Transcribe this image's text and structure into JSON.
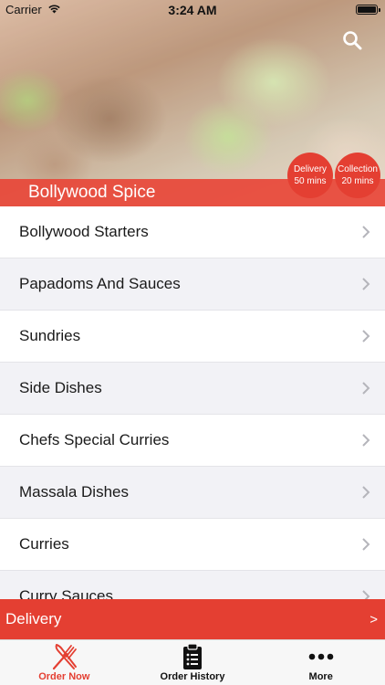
{
  "status_bar": {
    "carrier": "Carrier",
    "time": "3:24 AM"
  },
  "header": {
    "restaurant_name": "Bollywood Spice",
    "delivery_badge": {
      "label": "Delivery",
      "time": "50 mins"
    },
    "collection_badge": {
      "label": "Collection",
      "time": "20 mins"
    }
  },
  "menu": {
    "items": [
      {
        "label": "Bollywood Starters"
      },
      {
        "label": "Papadoms And Sauces"
      },
      {
        "label": "Sundries"
      },
      {
        "label": "Side Dishes"
      },
      {
        "label": "Chefs Special Curries"
      },
      {
        "label": "Massala Dishes"
      },
      {
        "label": "Curries"
      },
      {
        "label": "Curry Sauces"
      }
    ]
  },
  "delivery_bar": {
    "label": "Delivery",
    "arrow": ">"
  },
  "tabs": [
    {
      "label": "Order Now",
      "icon": "fork-knife-icon",
      "active": true
    },
    {
      "label": "Order History",
      "icon": "clipboard-list-icon",
      "active": false
    },
    {
      "label": "More",
      "icon": "more-dots-icon",
      "active": false
    }
  ],
  "colors": {
    "accent": "#e43f32",
    "list_alt_row": "#f2f2f6",
    "tab_bar": "#f7f7f7"
  }
}
